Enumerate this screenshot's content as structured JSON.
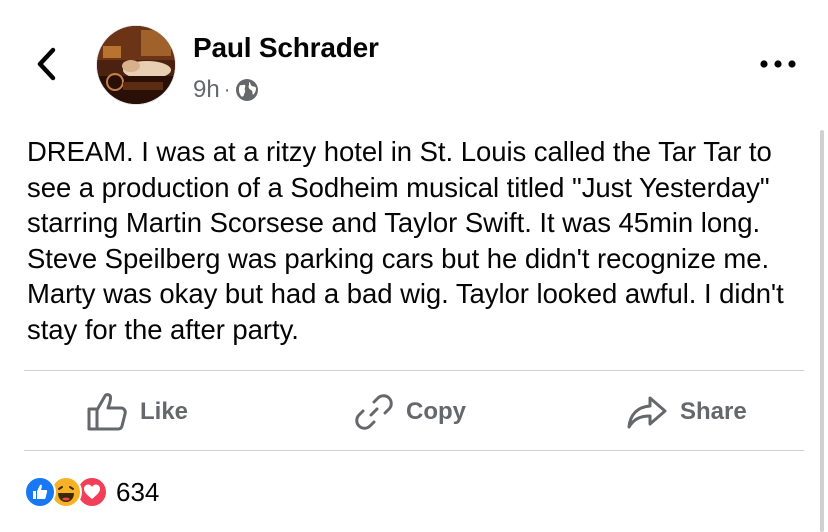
{
  "post": {
    "author": "Paul Schrader",
    "time": "9h",
    "separator": "·",
    "visibility_icon": "globe-icon",
    "text": "DREAM. I was at a ritzy hotel in St. Louis called the Tar Tar to see a production of a Sodheim musical titled \"Just Yesterday\" starring Martin Scorsese and Taylor Swift. It was 45min long. Steve Speilberg was parking cars but he didn't recognize me. Marty was okay but had a bad wig. Taylor looked awful. I didn't stay for the after party."
  },
  "actions": {
    "like_label": "Like",
    "copy_label": "Copy",
    "share_label": "Share"
  },
  "reactions": {
    "icons": [
      "like-reaction-icon",
      "haha-reaction-icon",
      "love-reaction-icon"
    ],
    "count": "634"
  },
  "colors": {
    "like_blue": "#1877f2",
    "love_red": "#f33e58",
    "haha_yellow": "#f7b125",
    "secondary_text": "#65676b"
  }
}
